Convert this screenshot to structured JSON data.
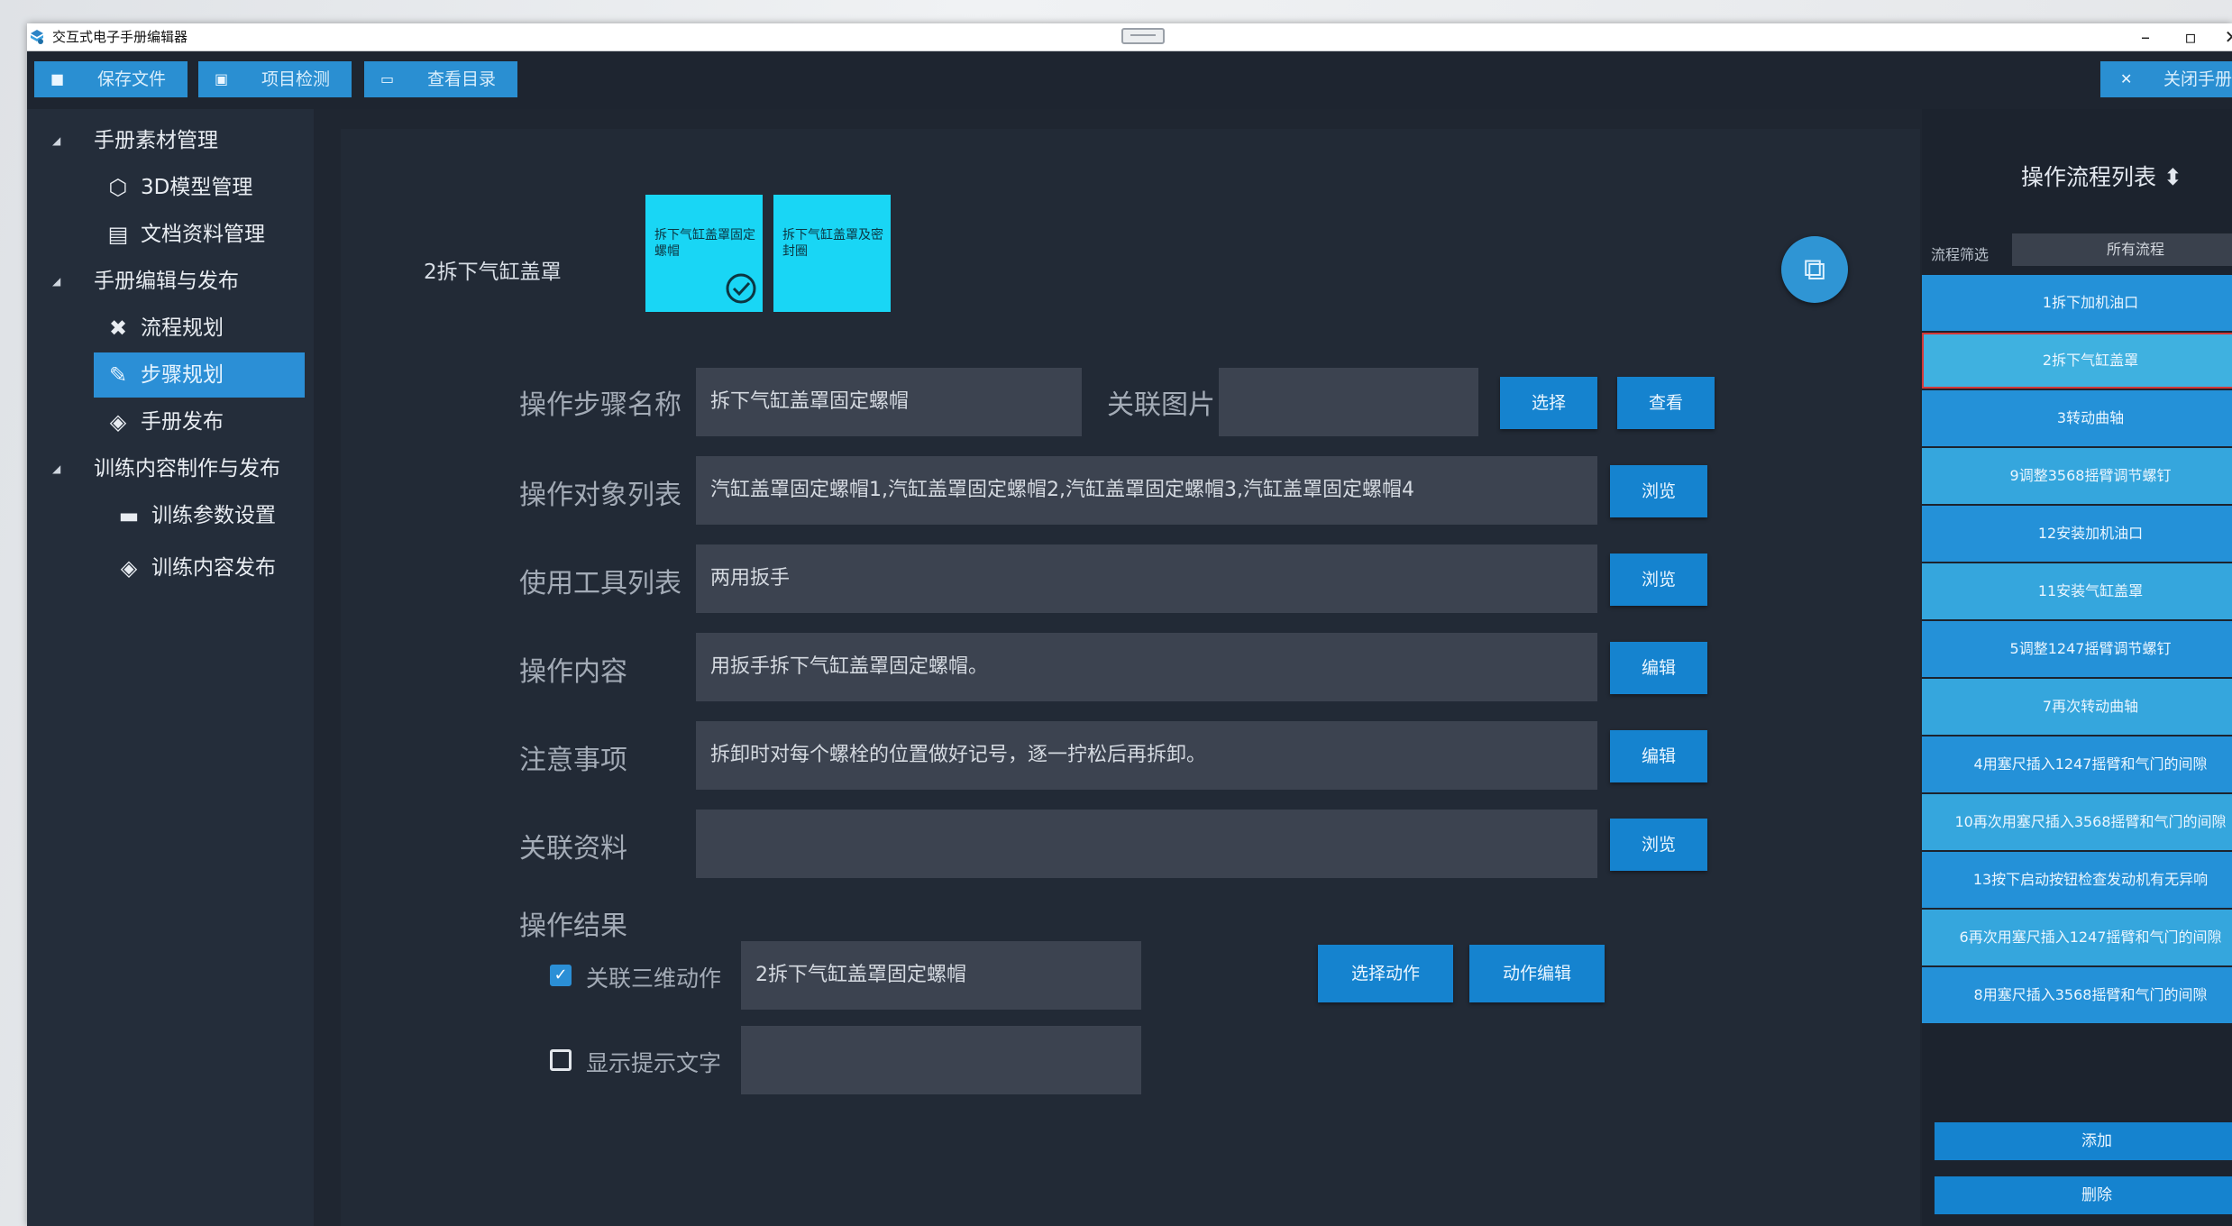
{
  "window": {
    "title": "交互式电子手册编辑器",
    "controls": {
      "minimize": "–",
      "maximize": "▫",
      "close": "✕"
    }
  },
  "toolbar": {
    "save_label": "保存文件",
    "check_label": "项目检测",
    "catalog_label": "查看目录",
    "close_label": "关闭手册"
  },
  "sidebar": {
    "groups": [
      {
        "label": "手册素材管理"
      },
      {
        "label": "手册编辑与发布"
      },
      {
        "label": "训练内容制作与发布"
      }
    ],
    "items": [
      {
        "label": "3D模型管理",
        "icon": "cube-icon"
      },
      {
        "label": "文档资料管理",
        "icon": "document-icon"
      },
      {
        "label": "流程规划",
        "icon": "tools-icon"
      },
      {
        "label": "步骤规划",
        "icon": "edit-icon"
      },
      {
        "label": "手册发布",
        "icon": "layers-icon"
      },
      {
        "label": "训练参数设置",
        "icon": "controller-icon"
      },
      {
        "label": "训练内容发布",
        "icon": "layers-icon"
      }
    ]
  },
  "main": {
    "current_flow": "2拆下气缸盖罩",
    "steps": [
      {
        "label": "拆下气缸盖罩固定螺帽",
        "done": true
      },
      {
        "label": "拆下气缸盖罩及密封圈",
        "done": false
      }
    ],
    "form": {
      "step_name_label": "操作步骤名称",
      "step_name_value": "拆下气缸盖罩固定螺帽",
      "image_label": "关联图片",
      "image_value": "",
      "select_label": "选择",
      "view_label": "查看",
      "objects_label": "操作对象列表",
      "objects_value": "汽缸盖罩固定螺帽1,汽缸盖罩固定螺帽2,汽缸盖罩固定螺帽3,汽缸盖罩固定螺帽4",
      "tools_label": "使用工具列表",
      "tools_value": "两用扳手",
      "content_label": "操作内容",
      "content_value": "用扳手拆下气缸盖罩固定螺帽。",
      "notes_label": "注意事项",
      "notes_value": "拆卸时对每个螺栓的位置做好记号，逐一拧松后再拆卸。",
      "materials_label": "关联资料",
      "materials_value": "",
      "browse_label": "浏览",
      "edit_label": "编辑",
      "result_label": "操作结果",
      "link3d_label": "关联三维动作",
      "link3d_checked": true,
      "link3d_value": "2拆下气缸盖罩固定螺帽",
      "select_action_label": "选择动作",
      "action_edit_label": "动作编辑",
      "hint_label": "显示提示文字",
      "hint_checked": false,
      "hint_value": ""
    }
  },
  "flow_panel": {
    "title": "操作流程列表",
    "filter_label": "流程筛选",
    "filter_value": "所有流程",
    "items": [
      "1拆下加机油口",
      "2拆下气缸盖罩",
      "3转动曲轴",
      "9调整3568摇臂调节螺钉",
      "12安装加机油口",
      "11安装气缸盖罩",
      "5调整1247摇臂调节螺钉",
      "7再次转动曲轴",
      "4用塞尺插入1247摇臂和气门的间隙",
      "10再次用塞尺插入3568摇臂和气门的间隙",
      "13按下启动按钮检查发动机有无异响",
      "6再次用塞尺插入1247摇臂和气门的间隙",
      "8用塞尺插入3568摇臂和气门的间隙"
    ],
    "selected_index": 1,
    "add_label": "添加",
    "delete_label": "删除"
  }
}
